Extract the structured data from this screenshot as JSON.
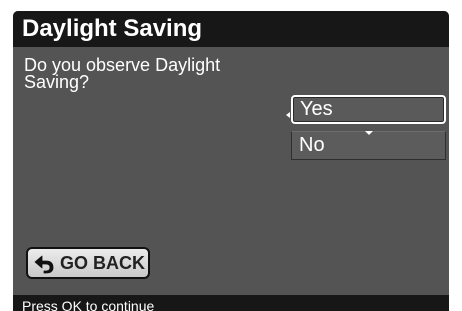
{
  "dialog": {
    "title": "Daylight Saving",
    "question": "Do you observe Daylight Saving?",
    "options": [
      {
        "label": "Yes",
        "selected": true
      },
      {
        "label": "No",
        "selected": false
      }
    ],
    "back_button": {
      "label": "GO BACK",
      "icon": "back-arrow-icon"
    },
    "footer_hint": "Press OK to continue"
  },
  "colors": {
    "panel": "#545454",
    "title_bar": "#171717",
    "text": "#ffffff",
    "button_bg": "#e0e0e0"
  }
}
